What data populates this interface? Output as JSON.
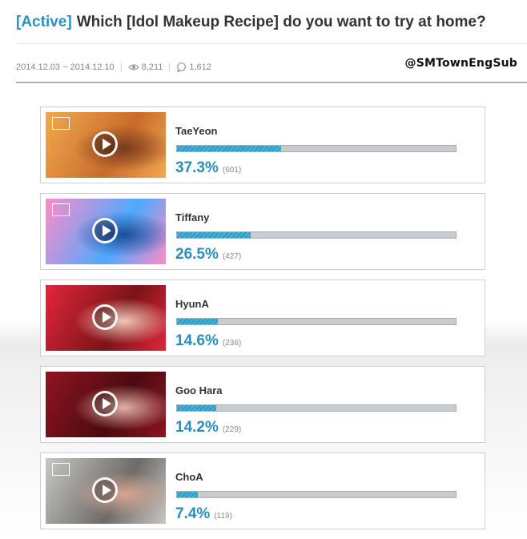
{
  "header": {
    "status": "[Active]",
    "title": "Which [Idol Makeup Recipe] do you want to try at home?",
    "date_range": "2014.12.03 ~ 2014.12.10",
    "views": "8,211",
    "comments": "1,612",
    "watermark": "@SMTownEngSub"
  },
  "colors": {
    "accent": "#2d8fc4",
    "bar_track": "#c8ccd0",
    "percent_text": "#2a8dbd"
  },
  "options": [
    {
      "name": "TaeYeon",
      "percent": "37.3%",
      "count": "(601)",
      "fraction": 0.373,
      "thumb_colors": [
        "#f2a94e",
        "#c86b2b",
        "#7a3a1e"
      ]
    },
    {
      "name": "Tiffany",
      "percent": "26.5%",
      "count": "(427)",
      "fraction": 0.265,
      "thumb_colors": [
        "#ff8cc7",
        "#4da9ff",
        "#1c4e9a"
      ]
    },
    {
      "name": "HyunA",
      "percent": "14.6%",
      "count": "(236)",
      "fraction": 0.146,
      "thumb_colors": [
        "#e2263a",
        "#7b1318",
        "#f1c7ba"
      ]
    },
    {
      "name": "Goo Hara",
      "percent": "14.2%",
      "count": "(229)",
      "fraction": 0.142,
      "thumb_colors": [
        "#8f1421",
        "#4a0b10",
        "#e5b0a4"
      ]
    },
    {
      "name": "ChoA",
      "percent": "7.4%",
      "count": "(119)",
      "fraction": 0.074,
      "thumb_colors": [
        "#c9c7c3",
        "#6d6a67",
        "#d8a691"
      ]
    }
  ]
}
